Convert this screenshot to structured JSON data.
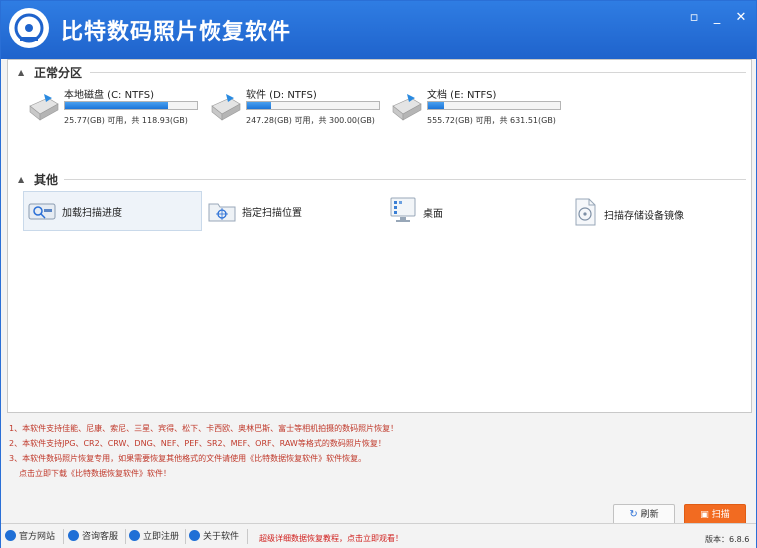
{
  "app": {
    "title": "比特数码照片恢复软件"
  },
  "window_controls": {
    "restore": "▫",
    "minimize": "_",
    "close": "✕"
  },
  "sections": {
    "normal": {
      "label": "正常分区"
    },
    "other": {
      "label": "其他"
    }
  },
  "drives": [
    {
      "name": "本地磁盘 (C: NTFS)",
      "size": "25.77(GB) 可用，共 118.93(GB)",
      "usage": 0.78,
      "icon": "hard-drive-icon"
    },
    {
      "name": "软件 (D: NTFS)",
      "size": "247.28(GB) 可用，共 300.00(GB)",
      "usage": 0.18,
      "icon": "hard-drive-icon"
    },
    {
      "name": "文档 (E: NTFS)",
      "size": "555.72(GB) 可用，共 631.51(GB)",
      "usage": 0.12,
      "icon": "hard-drive-icon"
    }
  ],
  "other_items": [
    {
      "label": "加载扫描进度",
      "icon": "load-progress-icon"
    },
    {
      "label": "指定扫描位置",
      "icon": "folder-target-icon"
    },
    {
      "label": "桌面",
      "icon": "desktop-icon"
    },
    {
      "label": "扫描存储设备镜像",
      "icon": "disk-image-icon"
    }
  ],
  "notes": [
    "1、本软件支持佳能、尼康、索尼、三星、宾得、松下、卡西欧、奥林巴斯、富士等相机拍摄的数码照片恢复！",
    "2、本软件支持JPG、CR2、CRW、DNG、NEF、PEF、SR2、MEF、ORF、RAW等格式的数码照片恢复！",
    "3、本软件数码照片恢复专用，如果需要恢复其他格式的文件请使用《比特数据恢复软件》软件恢复。",
    "点击立即下载《比特数据恢复软件》软件！"
  ],
  "buttons": {
    "refresh": "刷新",
    "scan": "扫描"
  },
  "statusbar": {
    "items": [
      {
        "label": "官方网站",
        "icon": "home-icon"
      },
      {
        "label": "咨询客服",
        "icon": "chat-icon"
      },
      {
        "label": "立即注册",
        "icon": "user-icon"
      },
      {
        "label": "关于软件",
        "icon": "info-icon"
      }
    ],
    "tutorial_link": "超级详细数据恢复教程，点击立即观看！",
    "version": "版本：6.8.6"
  }
}
